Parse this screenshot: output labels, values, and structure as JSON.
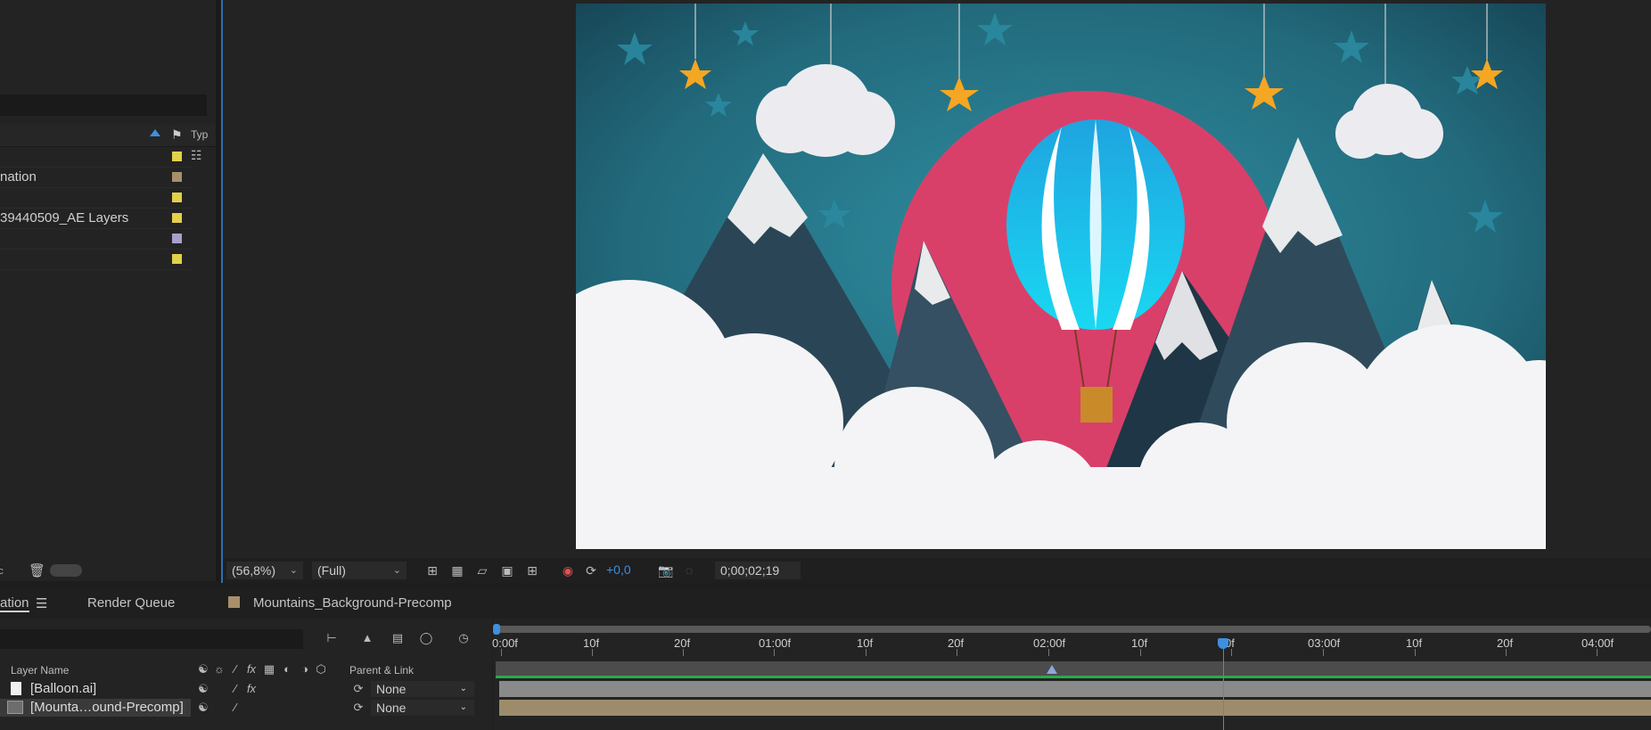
{
  "project": {
    "sort_arrow": "sort-ascending-icon",
    "type_col": "Typ",
    "rows": [
      {
        "label": "",
        "color": "#e3d14a"
      },
      {
        "label": "nation",
        "color": "#a88f6c"
      },
      {
        "label": "",
        "color": "#e3d14a"
      },
      {
        "label": "39440509_AE Layers",
        "color": "#e3d14a"
      },
      {
        "label": "",
        "color": "#a8a0c8"
      },
      {
        "label": "",
        "color": "#e3d14a"
      }
    ],
    "bottom_text": "bpc"
  },
  "viewer": {
    "zoom": "(56,8%)",
    "resolution": "(Full)",
    "exposure": "+0,0",
    "timecode": "0;00;02;19"
  },
  "timeline": {
    "tabs": {
      "composition": "ation",
      "render_queue": "Render Queue",
      "precomp": "Mountains_Background-Precomp",
      "precomp_color": "#a88f6c"
    },
    "columns": {
      "layer_name": "Layer Name",
      "parent_link": "Parent & Link"
    },
    "ruler": [
      "0:00f",
      "10f",
      "20f",
      "01:00f",
      "10f",
      "20f",
      "02:00f",
      "10f",
      "0f",
      "03:00f",
      "10f",
      "20f",
      "04:00f"
    ],
    "layers": [
      {
        "name": "[Balloon.ai]",
        "parent": "None",
        "fx": "fx"
      },
      {
        "name": "[Mounta…ound-Precomp]",
        "parent": "None",
        "fx": ""
      }
    ]
  }
}
